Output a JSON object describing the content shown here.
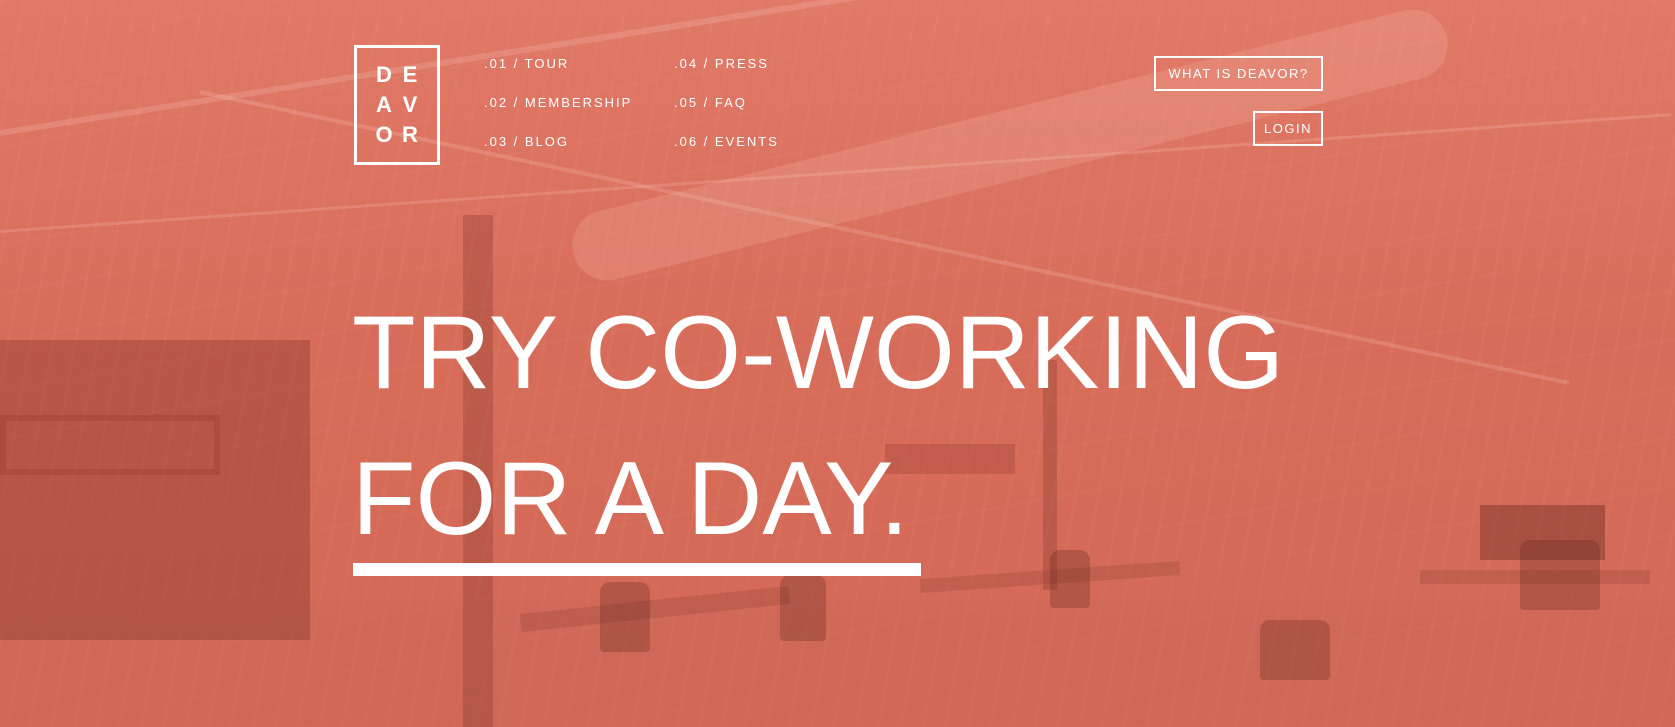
{
  "logo": {
    "letters": [
      "D",
      "E",
      "A",
      "V",
      "O",
      "R"
    ]
  },
  "nav": {
    "items": [
      {
        "label": ".01 / TOUR"
      },
      {
        "label": ".02 / MEMBERSHIP"
      },
      {
        "label": ".03 / BLOG"
      },
      {
        "label": ".04 / PRESS"
      },
      {
        "label": ".05 / FAQ"
      },
      {
        "label": ".06 / EVENTS"
      }
    ]
  },
  "header": {
    "what_is_label": "WHAT IS DEAVOR?",
    "login_label": "LOGIN"
  },
  "hero": {
    "headline_line1": "TRY CO-WORKING",
    "headline_line2": "FOR A DAY."
  },
  "colors": {
    "overlay": "#d86f5c",
    "text": "#ffffff"
  }
}
